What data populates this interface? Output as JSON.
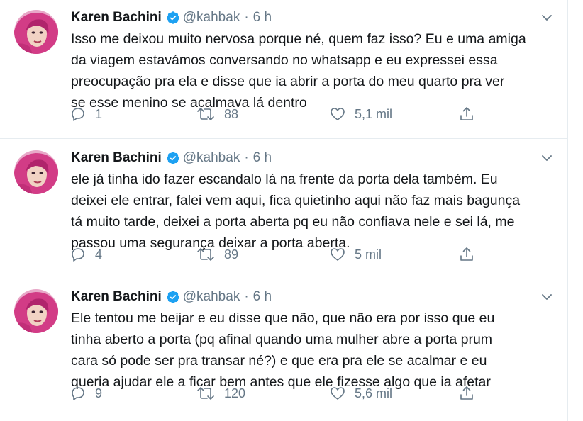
{
  "colors": {
    "verified": "#1da1f2",
    "muted": "#657786",
    "text": "#14171a"
  },
  "tweets": [
    {
      "name": "Karen Bachini",
      "handle": "@kahbak",
      "dot": "·",
      "time": "6 h",
      "text": "Isso me deixou muito nervosa porque né, quem faz isso? Eu e uma amiga\nda viagem estavámos conversando no whatsapp e eu expressei essa\npreocupação pra ela e disse que ia abrir a porta do meu quarto pra ver\nse esse menino se acalmava lá dentro",
      "replies": "1",
      "retweets": "88",
      "likes": "5,1 mil"
    },
    {
      "name": "Karen Bachini",
      "handle": "@kahbak",
      "dot": "·",
      "time": "6 h",
      "text": "ele já tinha ido fazer escandalo lá na frente da porta dela também. Eu\ndeixei ele entrar, falei vem aqui, fica quietinho aqui não faz mais bagunça\ntá muito tarde, deixei a porta aberta pq eu não confiava nele e sei lá, me\npassou uma segurança deixar a porta aberta.",
      "replies": "4",
      "retweets": "89",
      "likes": "5 mil"
    },
    {
      "name": "Karen Bachini",
      "handle": "@kahbak",
      "dot": "·",
      "time": "6 h",
      "text": "Ele tentou me beijar e eu disse que não, que não era por isso que eu\ntinha aberto a porta (pq afinal quando uma mulher abre a porta prum\ncara só pode ser pra transar né?) e que era pra ele se acalmar e eu\nqueria ajudar ele a ficar bem antes que ele fizesse algo que ia afetar",
      "replies": "9",
      "retweets": "120",
      "likes": "5,6 mil"
    }
  ]
}
